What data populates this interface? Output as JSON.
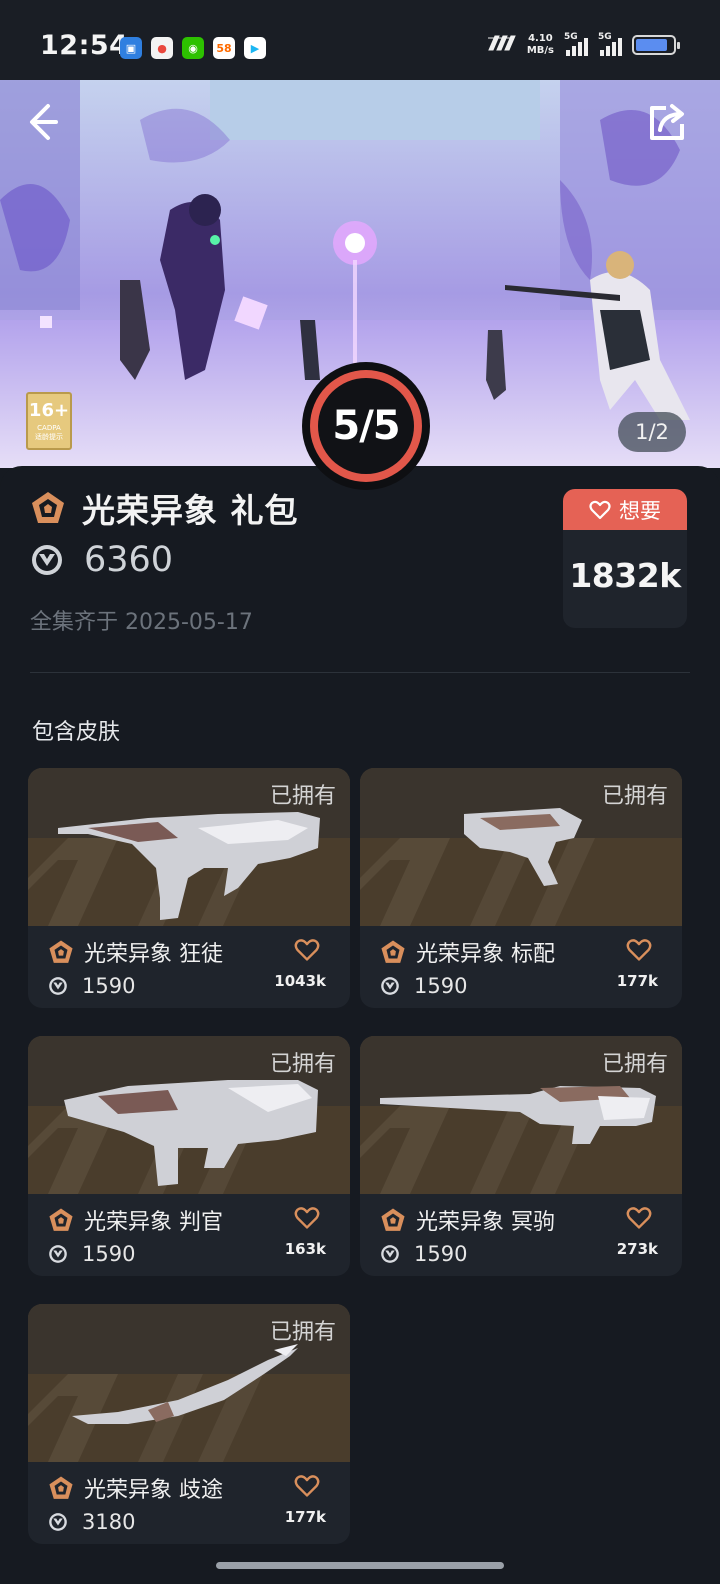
{
  "status_bar": {
    "time": "12:54",
    "apps": [
      {
        "icon": "photo-app-icon",
        "color": "#2f7fe0"
      },
      {
        "icon": "map-pin-app-icon",
        "color": "#e9473d"
      },
      {
        "icon": "wechat-app-icon",
        "color": "#2dc100"
      },
      {
        "icon": "58-app-icon",
        "color": "#ff6b00",
        "label": "58"
      },
      {
        "icon": "play-app-icon",
        "color": "#1bb6f2"
      }
    ],
    "carrier": "??",
    "speed_value": "4.10",
    "speed_unit": "MB/s",
    "net1": "5G",
    "net2": "5G",
    "battery_level": 0.85
  },
  "hero": {
    "age_rating": "16+",
    "age_org": "CADPA",
    "age_note": "适龄提示",
    "page_indicator": "1/2",
    "counter": "5/5"
  },
  "bundle": {
    "title": "光荣异象 礼包",
    "price": "6360",
    "complete_date": "全集齐于 2025-05-17",
    "want_label": "想要",
    "want_count": "1832k"
  },
  "section_title": "包含皮肤",
  "skins": [
    {
      "name": "光荣异象 狂徒",
      "price": "1590",
      "wants": "1043k",
      "status": "已拥有"
    },
    {
      "name": "光荣异象 标配",
      "price": "1590",
      "wants": "177k",
      "status": "已拥有"
    },
    {
      "name": "光荣异象 判官",
      "price": "1590",
      "wants": "163k",
      "status": "已拥有"
    },
    {
      "name": "光荣异象 冥驹",
      "price": "1590",
      "wants": "273k",
      "status": "已拥有"
    },
    {
      "name": "光荣异象 歧途",
      "price": "3180",
      "wants": "177k",
      "status": "已拥有"
    }
  ],
  "colors": {
    "background": "#161a21",
    "card": "#1f242c",
    "accent": "#e56255",
    "tier_icon": "#d98f5c"
  }
}
